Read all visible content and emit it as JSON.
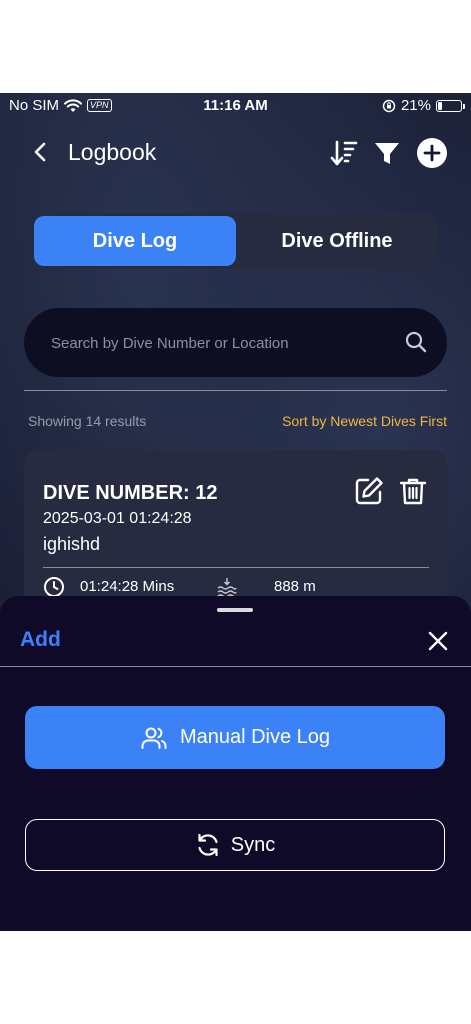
{
  "status_bar": {
    "carrier": "No SIM",
    "vpn": "VPN",
    "time": "11:16 AM",
    "battery": "21%",
    "battery_level": 0.21
  },
  "header": {
    "title": "Logbook"
  },
  "tabs": [
    {
      "label": "Dive Log",
      "active": true
    },
    {
      "label": "Dive Offline",
      "active": false
    }
  ],
  "search": {
    "placeholder": "Search by Dive Number or Location"
  },
  "results": {
    "count_text": "Showing 14 results",
    "sort_text": "Sort by Newest Dives First"
  },
  "dive_card": {
    "title": "DIVE NUMBER: 12",
    "datetime": "2025-03-01 01:24:28",
    "location": "ighishd",
    "duration": "01:24:28 Mins",
    "depth": "888 m"
  },
  "sheet": {
    "title": "Add",
    "manual_label": "Manual Dive Log",
    "sync_label": "Sync"
  },
  "colors": {
    "accent": "#3b82f6",
    "sort_link": "#f2b640",
    "sheet_bg": "#0e0a28",
    "card_bg": "#262b40"
  }
}
